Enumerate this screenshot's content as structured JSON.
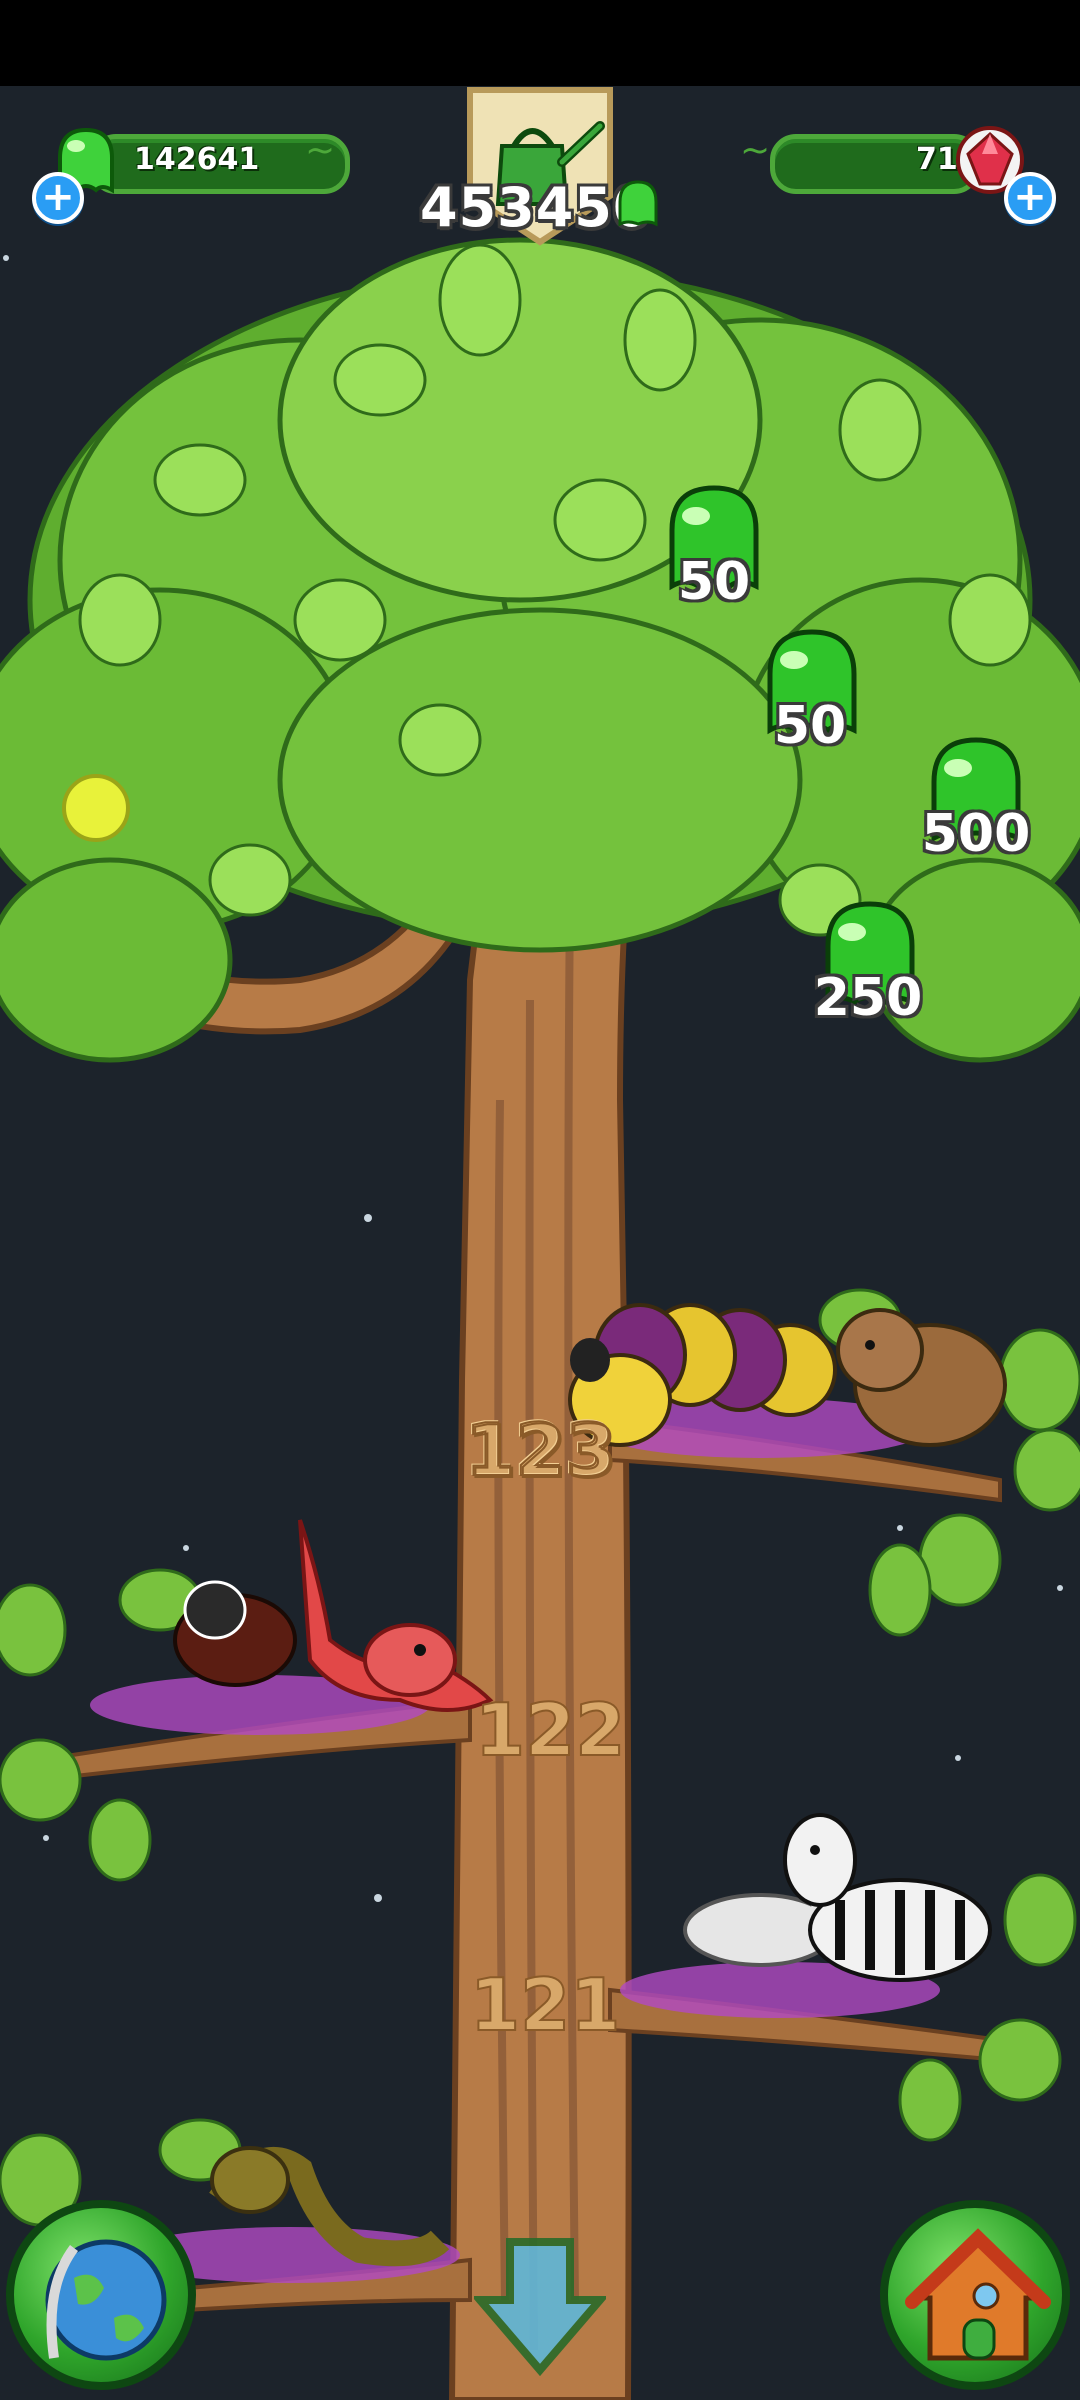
{
  "hud": {
    "slime_balance": "142641",
    "watering_can_total": "453450",
    "gems_balance": "71",
    "add_label": "+"
  },
  "drops": [
    {
      "value": "50"
    },
    {
      "value": "50"
    },
    {
      "value": "500"
    },
    {
      "value": "250"
    }
  ],
  "tree_levels": [
    {
      "level": "123"
    },
    {
      "level": "122"
    },
    {
      "level": "121"
    }
  ],
  "colors": {
    "slime_green": "#3fd23b",
    "hud_green": "#1f6b1c",
    "plus_blue": "#2a9df4",
    "trunk_brown": "#b77b47",
    "leaf_green": "#74c23d"
  },
  "icons": {
    "currency": "green-slime-icon",
    "premium": "red-gem-icon",
    "tool": "watering-can-icon",
    "world": "globe-icon",
    "home": "house-icon",
    "scroll": "down-arrow-icon"
  }
}
